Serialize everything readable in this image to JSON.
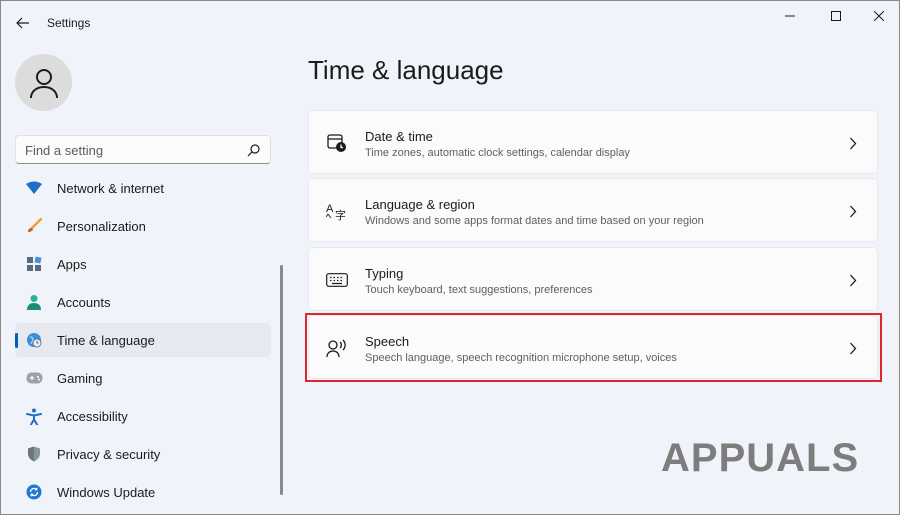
{
  "window": {
    "title": "Settings"
  },
  "sidebar": {
    "search_placeholder": "Find a setting",
    "items": [
      {
        "label": "Network & internet",
        "icon": "wifi-icon"
      },
      {
        "label": "Personalization",
        "icon": "brush-icon"
      },
      {
        "label": "Apps",
        "icon": "apps-icon"
      },
      {
        "label": "Accounts",
        "icon": "person-icon"
      },
      {
        "label": "Time & language",
        "icon": "globe-clock-icon",
        "selected": true
      },
      {
        "label": "Gaming",
        "icon": "gamepad-icon"
      },
      {
        "label": "Accessibility",
        "icon": "accessibility-icon"
      },
      {
        "label": "Privacy & security",
        "icon": "shield-icon"
      },
      {
        "label": "Windows Update",
        "icon": "update-icon"
      }
    ]
  },
  "main": {
    "title": "Time & language",
    "cards": [
      {
        "title": "Date & time",
        "description": "Time zones, automatic clock settings, calendar display",
        "icon": "calendar-clock-icon"
      },
      {
        "title": "Language & region",
        "description": "Windows and some apps format dates and time based on your region",
        "icon": "language-icon"
      },
      {
        "title": "Typing",
        "description": "Touch keyboard, text suggestions, preferences",
        "icon": "keyboard-icon"
      },
      {
        "title": "Speech",
        "description": "Speech language, speech recognition microphone setup, voices",
        "icon": "speech-icon",
        "highlighted": true
      }
    ]
  },
  "watermark": {
    "text": "APPUALS"
  },
  "colors": {
    "accent": "#005fb8",
    "highlight": "#e0252c",
    "background": "#f0f3f9"
  }
}
